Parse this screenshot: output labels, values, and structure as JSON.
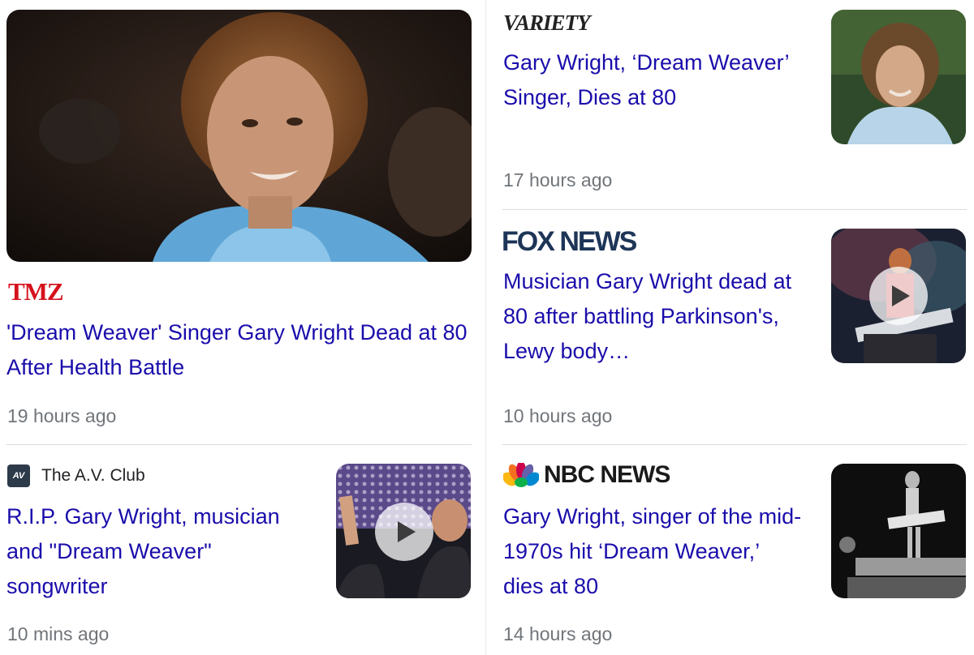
{
  "articles": [
    {
      "source": "TMZ",
      "title": "'Dream Weaver' Singer Gary Wright Dead at 80 After Health Battle",
      "time": "19 hours ago",
      "thumb_icon": "portrait-photo-icon",
      "video": false
    },
    {
      "source": "VARIETY",
      "title": "Gary Wright, ‘Dream Weaver’ Singer, Dies at 80",
      "time": "17 hours ago",
      "thumb_icon": "portrait-photo-icon",
      "video": false
    },
    {
      "source": "FOX NEWS",
      "title": "Musician Gary Wright dead at 80 after battling Parkinson's, Lewy body…",
      "time": "10 hours ago",
      "thumb_icon": "concert-photo-icon",
      "video": true
    },
    {
      "source": "The A.V. Club",
      "source_badge": "AV",
      "title": "R.I.P. Gary Wright, musician and \"Dream Weaver\" songwriter",
      "time": "10 mins ago",
      "thumb_icon": "concert-photo-icon",
      "video": true
    },
    {
      "source": "NBC NEWS",
      "title": "Gary Wright, singer of the mid-1970s hit ‘Dream Weaver,’ dies at 80",
      "time": "14 hours ago",
      "thumb_icon": "stage-photo-icon",
      "video": false
    }
  ],
  "colors": {
    "link": "#1a0dab",
    "time": "#70757a",
    "tmz_red": "#d5121d",
    "divider": "#dadce0"
  }
}
